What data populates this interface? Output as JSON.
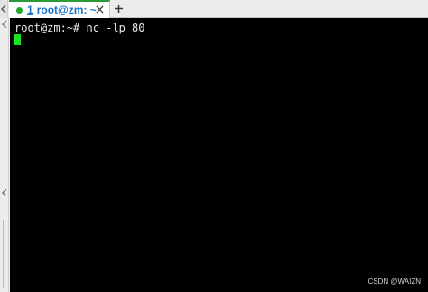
{
  "tab": {
    "number": "1",
    "title": "root@zm: ~",
    "close_icon": "close-icon",
    "active_color": "#2b9b3a",
    "status_color": "#22a72f"
  },
  "new_tab": {
    "label": "+"
  },
  "terminal": {
    "prompt_line": "root@zm:~# nc -lp 80",
    "background": "#000000",
    "foreground": "#e6e6e6",
    "cursor_color": "#19e51e"
  },
  "watermark": {
    "text": "CSDN @WAIZN"
  }
}
